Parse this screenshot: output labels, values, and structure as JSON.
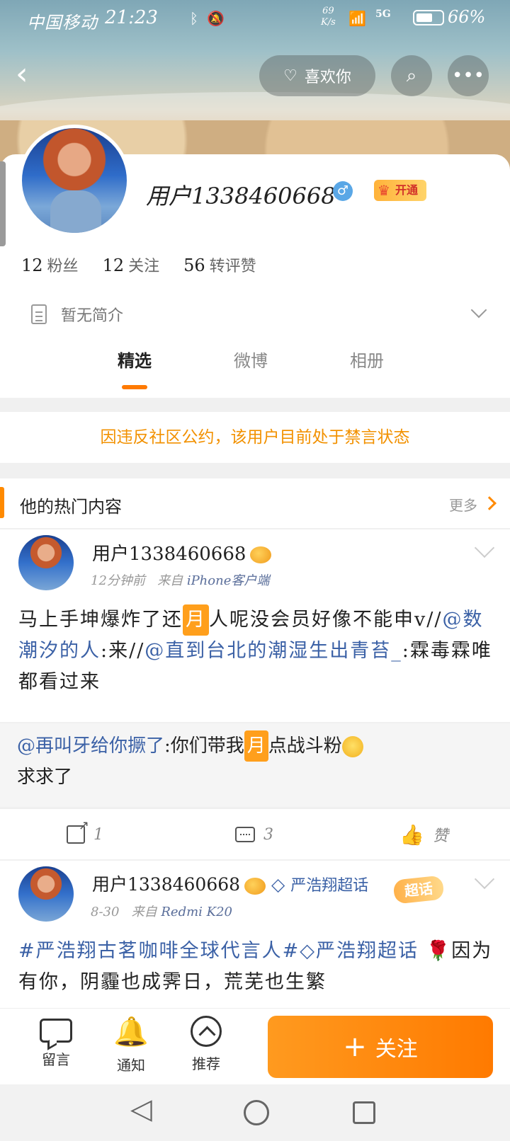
{
  "status_bar": {
    "carrier": "中国移动",
    "time": "21:23",
    "net_speed_value": "69",
    "net_speed_unit": "K/s",
    "network": "5G",
    "battery": "66%"
  },
  "header": {
    "like_label": "喜欢你"
  },
  "profile": {
    "username": "用户1338460668",
    "gender_symbol": "♂",
    "vip_label": "开通",
    "fans_count": "12",
    "fans_label": "粉丝",
    "following_count": "12",
    "following_label": "关注",
    "likes_count": "56",
    "likes_label": "转评赞",
    "intro": "暂无简介"
  },
  "tabs": [
    {
      "label": "精选"
    },
    {
      "label": "微博"
    },
    {
      "label": "相册"
    }
  ],
  "notice": "因违反社区公约，该用户目前处于禁言状态",
  "hot_section": {
    "title": "他的热门内容",
    "more_label": "更多"
  },
  "post1": {
    "username": "用户1338460668",
    "time": "12分钟前",
    "source_prefix": "来自",
    "source": "iPhone客户端",
    "text_a": "马上手坤爆炸了还",
    "moon": "月",
    "text_b": "人呢没会员好像不能申v//",
    "mention1": "@数潮汐的人",
    "text_c": ":来//",
    "mention2": "@直到台北的潮湿生出青苔_",
    "text_d": ":霖毒霖唯都看过来",
    "repost_mention": "@再叫牙给你撅了",
    "repost_a": ":你们带我",
    "repost_b": "点战斗粉",
    "repost_c": "求求了",
    "share_count": "1",
    "comment_count": "3",
    "like_label": "赞"
  },
  "post2": {
    "username": "用户1338460668",
    "topic": "严浩翔超话",
    "topic_badge": "超话",
    "time": "8-30",
    "source_prefix": "来自",
    "source": "Redmi K20",
    "hashtag": "#严浩翔古茗咖啡全球代言人#",
    "topic_inline": "严浩翔超话",
    "text": "因为有你，阴霾也成霁日，荒芜也生繁"
  },
  "bottom_bar": {
    "message_label": "留言",
    "notify_label": "通知",
    "recommend_label": "推荐",
    "follow_label": "关注"
  }
}
